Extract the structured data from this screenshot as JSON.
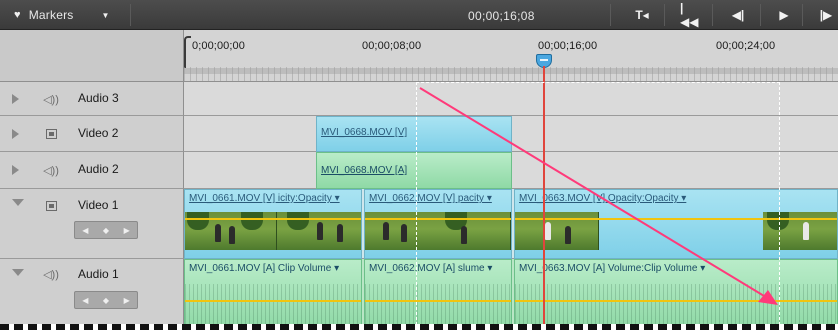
{
  "toolbar": {
    "markers_label": "Markers",
    "timecode": "00;00;16;08",
    "icons": [
      "marker-set-icon",
      "go-to-start-icon",
      "step-back-icon",
      "play-icon",
      "step-forward-icon"
    ]
  },
  "ruler": {
    "labels": [
      "0;00;00;00",
      "00;00;08;00",
      "00;00;16;00",
      "00;00;24;00"
    ]
  },
  "tracks": [
    {
      "name": "Audio 3",
      "kind": "audio",
      "expanded": false
    },
    {
      "name": "Video 2",
      "kind": "video",
      "expanded": false
    },
    {
      "name": "Audio 2",
      "kind": "audio",
      "expanded": false
    },
    {
      "name": "Video 1",
      "kind": "video",
      "expanded": true
    },
    {
      "name": "Audio 1",
      "kind": "audio",
      "expanded": true
    }
  ],
  "clips": {
    "video2": "MVI_0668.MOV [V]",
    "audio2": "MVI_0668.MOV [A]",
    "video1": [
      "MVI_0661.MOV [V] icity:Opacity ▾",
      "MVI_0662.MOV [V] pacity ▾",
      "MVI_0663.MOV [V] Opacity:Opacity ▾"
    ],
    "audio1": [
      "MVI_0661.MOV [A] Clip Volume ▾",
      "MVI_0662.MOV [A] slume ▾",
      "MVI_0663.MOV [A] Volume:Clip Volume ▾"
    ]
  },
  "colors": {
    "playhead": "#e0453c",
    "drag_arrow": "#ff3a7a",
    "video_clip": "#8fd6ec",
    "audio_clip": "#a0e0b4"
  }
}
